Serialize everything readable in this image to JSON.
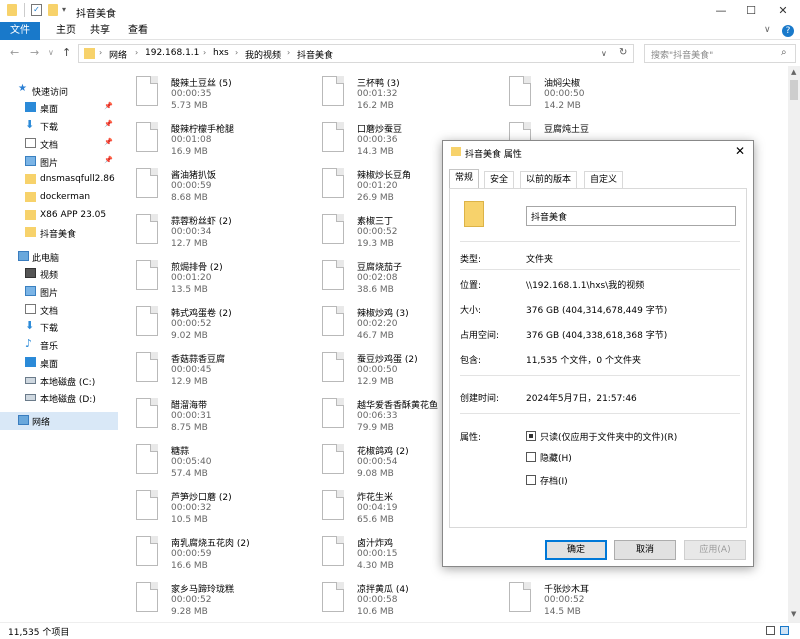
{
  "window": {
    "title": "抖音美食",
    "minimize": "—",
    "maximize": "☐",
    "close": "✕"
  },
  "ribbon": {
    "tabs": [
      "文件",
      "主页",
      "共享",
      "查看"
    ],
    "help": "?",
    "collapse": "∨"
  },
  "address": {
    "crumbs": [
      "网络",
      "192.168.1.1",
      "hxs",
      "我的视频",
      "抖音美食"
    ],
    "separator": "›",
    "search_placeholder": "搜索\"抖音美食\""
  },
  "sidebar": {
    "items": [
      {
        "label": "快速访问",
        "icon": "star-icon",
        "pinned": false
      },
      {
        "label": "桌面",
        "icon": "desktop-icon",
        "pinned": true
      },
      {
        "label": "下载",
        "icon": "download-icon",
        "pinned": true
      },
      {
        "label": "文档",
        "icon": "document-icon",
        "pinned": true
      },
      {
        "label": "图片",
        "icon": "picture-icon",
        "pinned": true
      },
      {
        "label": "dnsmasqfull2.86",
        "icon": "folder-icon",
        "pinned": false
      },
      {
        "label": "dockerman",
        "icon": "folder-icon",
        "pinned": false
      },
      {
        "label": "X86 APP 23.05",
        "icon": "folder-icon",
        "pinned": false
      },
      {
        "label": "抖音美食",
        "icon": "folder-icon",
        "pinned": false
      },
      {
        "label": "此电脑",
        "icon": "computer-icon",
        "pinned": false
      },
      {
        "label": "视频",
        "icon": "video-icon",
        "pinned": false
      },
      {
        "label": "图片",
        "icon": "picture-icon",
        "pinned": false
      },
      {
        "label": "文档",
        "icon": "document-icon",
        "pinned": false
      },
      {
        "label": "下载",
        "icon": "download-icon",
        "pinned": false
      },
      {
        "label": "音乐",
        "icon": "music-icon",
        "pinned": false
      },
      {
        "label": "桌面",
        "icon": "desktop-icon",
        "pinned": false
      },
      {
        "label": "本地磁盘 (C:)",
        "icon": "disk-icon",
        "pinned": false
      },
      {
        "label": "本地磁盘 (D:)",
        "icon": "disk-icon",
        "pinned": false
      },
      {
        "label": "网络",
        "icon": "network-icon",
        "pinned": false
      }
    ]
  },
  "files": {
    "col1": [
      {
        "name": "酸辣土豆丝 (5)",
        "duration": "00:00:35",
        "size": "5.73 MB"
      },
      {
        "name": "酸辣柠檬手枪腿",
        "duration": "00:01:08",
        "size": "16.9 MB"
      },
      {
        "name": "酱油猪扒饭",
        "duration": "00:00:59",
        "size": "8.68 MB"
      },
      {
        "name": "蒜蓉粉丝虾 (2)",
        "duration": "00:00:34",
        "size": "12.7 MB"
      },
      {
        "name": "煎焗排骨 (2)",
        "duration": "00:01:20",
        "size": "13.5 MB"
      },
      {
        "name": "韩式鸡蛋卷 (2)",
        "duration": "00:00:52",
        "size": "9.02 MB"
      },
      {
        "name": "香菇蒜香豆腐",
        "duration": "00:00:45",
        "size": "12.9 MB"
      },
      {
        "name": "醋溜海带",
        "duration": "00:00:31",
        "size": "8.75 MB"
      },
      {
        "name": "糖蒜",
        "duration": "00:05:40",
        "size": "57.4 MB"
      },
      {
        "name": "芦笋炒口蘑 (2)",
        "duration": "00:00:32",
        "size": "10.5 MB"
      },
      {
        "name": "南乳腐烧五花肉 (2)",
        "duration": "00:00:59",
        "size": "16.6 MB"
      },
      {
        "name": "家乡马蹄玲珑糕",
        "duration": "00:00:52",
        "size": "9.28 MB"
      }
    ],
    "col2": [
      {
        "name": "三杯鸭 (3)",
        "duration": "00:01:32",
        "size": "16.2 MB"
      },
      {
        "name": "口蘑炒蚕豆",
        "duration": "00:00:36",
        "size": "14.3 MB"
      },
      {
        "name": "辣椒炒长豆角",
        "duration": "00:01:20",
        "size": "26.9 MB"
      },
      {
        "name": "素椒三丁",
        "duration": "00:00:52",
        "size": "19.3 MB"
      },
      {
        "name": "豆腐烧茄子",
        "duration": "00:02:08",
        "size": "38.6 MB"
      },
      {
        "name": "辣椒炒鸡 (3)",
        "duration": "00:02:20",
        "size": "46.7 MB"
      },
      {
        "name": "蚕豆炒鸡蛋 (2)",
        "duration": "00:00:50",
        "size": "12.9 MB"
      },
      {
        "name": "越华爱香香酥黄花鱼",
        "duration": "00:06:33",
        "size": "79.9 MB"
      },
      {
        "name": "花椒鸽鸡 (2)",
        "duration": "00:00:54",
        "size": "9.08 MB"
      },
      {
        "name": "炸花生米",
        "duration": "00:04:19",
        "size": "65.6 MB"
      },
      {
        "name": "卤汁炸鸡",
        "duration": "00:00:15",
        "size": "4.30 MB"
      },
      {
        "name": "凉拌黄瓜 (4)",
        "duration": "00:00:58",
        "size": "10.6 MB"
      }
    ],
    "col3": [
      {
        "name": "油焖尖椒",
        "duration": "00:00:50",
        "size": "14.2 MB"
      },
      {
        "name": "豆腐炖土豆",
        "duration": "",
        "size": ""
      },
      {
        "name": "千张炒木耳",
        "duration": "00:00:52",
        "size": "14.5 MB"
      }
    ]
  },
  "statusbar": {
    "count": "11,535 个项目"
  },
  "dialog": {
    "title": "抖音美食 属性",
    "close": "✕",
    "tabs": [
      "常规",
      "安全",
      "以前的版本",
      "自定义"
    ],
    "name_value": "抖音美食",
    "rows": [
      {
        "label": "类型:",
        "value": "文件夹"
      },
      {
        "label": "位置:",
        "value": "\\\\192.168.1.1\\hxs\\我的视频"
      },
      {
        "label": "大小:",
        "value": "376 GB (404,314,678,449 字节)"
      },
      {
        "label": "占用空间:",
        "value": "376 GB (404,338,618,368 字节)"
      },
      {
        "label": "包含:",
        "value": "11,535 个文件，0 个文件夹"
      },
      {
        "label": "创建时间:",
        "value": "2024年5月7日，21:57:46"
      }
    ],
    "attributes_label": "属性:",
    "attributes": [
      {
        "label": "只读(仅应用于文件夹中的文件)(R)",
        "state": "indeterminate"
      },
      {
        "label": "隐藏(H)",
        "state": "unchecked"
      },
      {
        "label": "存档(I)",
        "state": "unchecked"
      }
    ],
    "buttons": {
      "ok": "确定",
      "cancel": "取消",
      "apply": "应用(A)"
    }
  },
  "colors": {
    "accent": "#1979ca",
    "folder": "#f7d26b",
    "selection": "#d9e8f7"
  }
}
